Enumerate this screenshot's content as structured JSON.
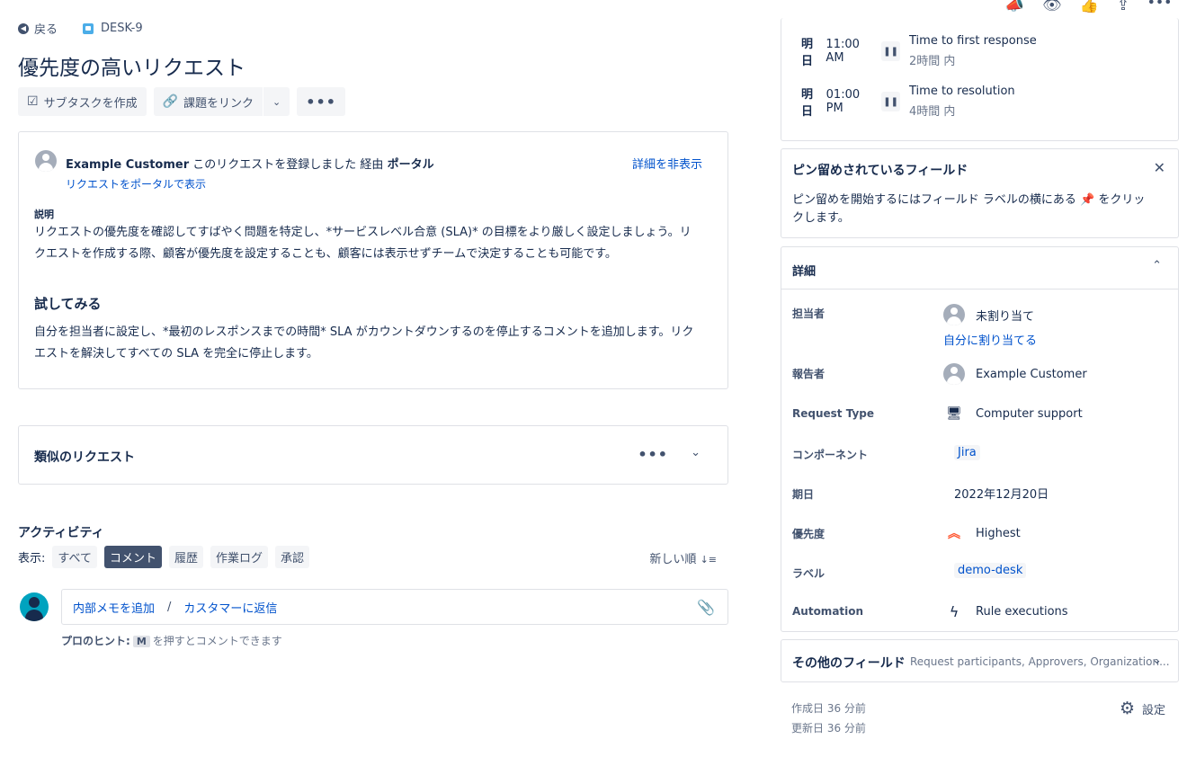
{
  "breadcrumb": {
    "back_label": "戻る",
    "issue_key": "DESK-9"
  },
  "title": "優先度の高いリクエスト",
  "toolbar": {
    "create_subtask": "サブタスクを作成",
    "link_issue": "課題をリンク"
  },
  "description_card": {
    "reporter_name": "Example Customer",
    "reporter_action": " このリクエストを登録しました 経由 ",
    "channel": "ポータル",
    "view_in_portal": "リクエストをポータルで表示",
    "hide_details": "詳細を非表示",
    "desc_label": "説明",
    "desc_text": "リクエストの優先度を確認してすばやく問題を特定し、*サービスレベル合意 (SLA)* の目標をより厳しく設定しましょう。リクエストを作成する際、顧客が優先度を設定することも、顧客には表示せずチームで決定することも可能です。",
    "try_heading": "試してみる",
    "try_text": "自分を担当者に設定し、*最初のレスポンスまでの時間* SLA がカウントダウンするのを停止するコメントを追加します。リクエストを解決してすべての SLA を完全に停止します。"
  },
  "similar": {
    "label": "類似のリクエスト"
  },
  "activity": {
    "heading": "アクティビティ",
    "show_label": "表示:",
    "filters": [
      "すべて",
      "コメント",
      "履歴",
      "作業ログ",
      "承認"
    ],
    "active_filter": "コメント",
    "sort_label": "新しい順",
    "internal_note": "内部メモを追加",
    "slash": "/",
    "reply_customer": "カスタマーに返信",
    "hint_prefix": "プロのヒント:",
    "hint_key": "M",
    "hint_suffix": "を押すとコメントできます"
  },
  "sla": [
    {
      "day": "明日",
      "time": "11:00 AM",
      "name": "Time to first response",
      "remaining": "2時間 内"
    },
    {
      "day": "明日",
      "time": "01:00 PM",
      "name": "Time to resolution",
      "remaining": "4時間 内"
    }
  ],
  "pinned": {
    "heading": "ピン留めされているフィールド",
    "text_before": "ピン留めを開始するにはフィールド ラベルの横にある ",
    "text_after": " をクリックします。"
  },
  "details": {
    "heading": "詳細",
    "assignee_label": "担当者",
    "assignee_value": "未割り当て",
    "assign_to_me": "自分に割り当てる",
    "reporter_label": "報告者",
    "reporter_value": "Example Customer",
    "request_type_label": "Request Type",
    "request_type_value": "Computer support",
    "component_label": "コンポーネント",
    "component_value": "Jira",
    "due_label": "期日",
    "due_value": "2022年12月20日",
    "priority_label": "優先度",
    "priority_value": "Highest",
    "labels_label": "ラベル",
    "labels_value": "demo-desk",
    "automation_label": "Automation",
    "automation_value": "Rule executions"
  },
  "other_fields": {
    "heading": "その他のフィールド",
    "summary": "Request participants, Approvers, Organization..."
  },
  "meta": {
    "created": "作成日 36 分前",
    "updated": "更新日 36 分前",
    "settings": "設定"
  },
  "colors": {
    "link": "#0052cc",
    "text": "#172b4d",
    "priority_highest": "#ff5630",
    "active_chip": "#42526e"
  }
}
